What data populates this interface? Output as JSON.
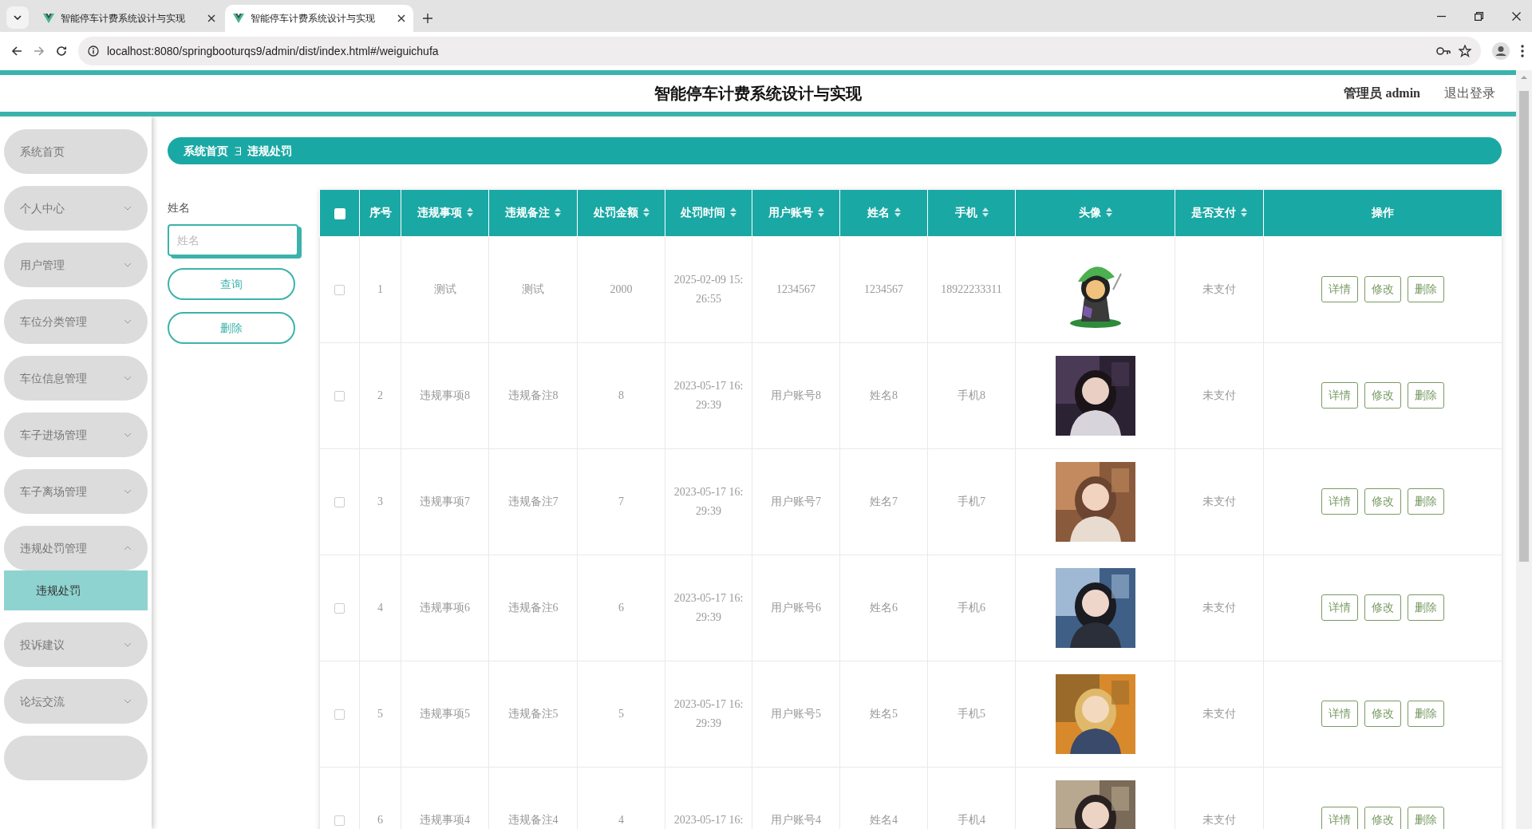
{
  "browser": {
    "tabs": [
      {
        "title": "智能停车计费系统设计与实现",
        "selected": false
      },
      {
        "title": "智能停车计费系统设计与实现",
        "selected": true
      }
    ],
    "url": "localhost:8080/springbooturqs9/admin/dist/index.html#/weiguichufa"
  },
  "header": {
    "title": "智能停车计费系统设计与实现",
    "user": "管理员 admin",
    "logout": "退出登录"
  },
  "sidebar": {
    "items": [
      {
        "label": "系统首页",
        "kind": "link"
      },
      {
        "label": "个人中心",
        "kind": "group",
        "expanded": false
      },
      {
        "label": "用户管理",
        "kind": "group",
        "expanded": false
      },
      {
        "label": "车位分类管理",
        "kind": "group",
        "expanded": false
      },
      {
        "label": "车位信息管理",
        "kind": "group",
        "expanded": false
      },
      {
        "label": "车子进场管理",
        "kind": "group",
        "expanded": false
      },
      {
        "label": "车子离场管理",
        "kind": "group",
        "expanded": false
      },
      {
        "label": "违规处罚管理",
        "kind": "group",
        "expanded": true,
        "children": [
          {
            "label": "违规处罚",
            "selected": true
          }
        ]
      },
      {
        "label": "投诉建议",
        "kind": "group",
        "expanded": false
      },
      {
        "label": "论坛交流",
        "kind": "group",
        "expanded": false
      }
    ]
  },
  "breadcrumb": [
    "系统首页",
    "违规处罚"
  ],
  "search": {
    "label": "姓名",
    "placeholder": "姓名",
    "buttons": [
      "查询",
      "删除"
    ]
  },
  "table": {
    "select_all": false,
    "columns": [
      {
        "label": "序号",
        "sortable": false
      },
      {
        "label": "违规事项",
        "sortable": true
      },
      {
        "label": "违规备注",
        "sortable": true
      },
      {
        "label": "处罚金额",
        "sortable": true
      },
      {
        "label": "处罚时间",
        "sortable": true
      },
      {
        "label": "用户账号",
        "sortable": true
      },
      {
        "label": "姓名",
        "sortable": true
      },
      {
        "label": "手机",
        "sortable": true
      },
      {
        "label": "头像",
        "sortable": true
      },
      {
        "label": "是否支付",
        "sortable": true
      },
      {
        "label": "操作",
        "sortable": false
      }
    ],
    "rows": [
      {
        "checked": false,
        "cells": [
          "1",
          "测试",
          "测试",
          "2000",
          "2025-02-09 15:26:55",
          "1234567",
          "1234567",
          "18922233311"
        ],
        "paid": "未支付",
        "actions": [
          "详情",
          "修改",
          "删除"
        ]
      },
      {
        "checked": false,
        "cells": [
          "2",
          "违规事项8",
          "违规备注8",
          "8",
          "2023-05-17 16:29:39",
          "用户账号8",
          "姓名8",
          "手机8"
        ],
        "paid": "未支付",
        "actions": [
          "详情",
          "修改",
          "删除"
        ]
      },
      {
        "checked": false,
        "cells": [
          "3",
          "违规事项7",
          "违规备注7",
          "7",
          "2023-05-17 16:29:39",
          "用户账号7",
          "姓名7",
          "手机7"
        ],
        "paid": "未支付",
        "actions": [
          "详情",
          "修改",
          "删除"
        ]
      },
      {
        "checked": false,
        "cells": [
          "4",
          "违规事项6",
          "违规备注6",
          "6",
          "2023-05-17 16:29:39",
          "用户账号6",
          "姓名6",
          "手机6"
        ],
        "paid": "未支付",
        "actions": [
          "详情",
          "修改",
          "删除"
        ]
      },
      {
        "checked": false,
        "cells": [
          "5",
          "违规事项5",
          "违规备注5",
          "5",
          "2023-05-17 16:29:39",
          "用户账号5",
          "姓名5",
          "手机5"
        ],
        "paid": "未支付",
        "actions": [
          "详情",
          "修改",
          "删除"
        ]
      },
      {
        "checked": false,
        "cells": [
          "6",
          "违规事项4",
          "违规备注4",
          "4",
          "2023-05-17 16:",
          "用户账号4",
          "姓名4",
          "手机4"
        ],
        "paid": "未支付",
        "actions": [
          "详情",
          "修改",
          "删除"
        ]
      }
    ]
  }
}
